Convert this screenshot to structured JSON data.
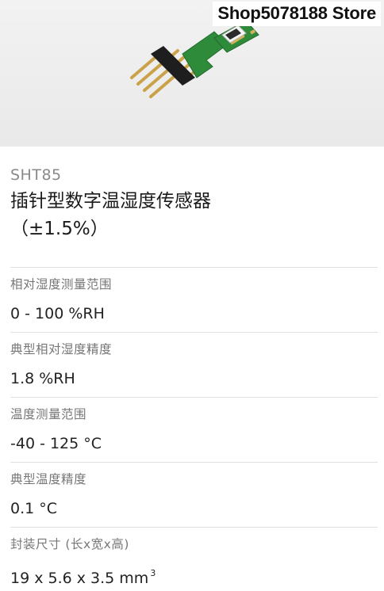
{
  "store_badge": "Shop5078188 Store",
  "product": {
    "model": "SHT85",
    "title_line1": "插针型数字温湿度传感器",
    "title_line2": "（±1.5%）"
  },
  "specs": [
    {
      "label": "相对湿度测量范围",
      "value": "0 - 100 %RH"
    },
    {
      "label": "典型相对湿度精度",
      "value": "1.8 %RH"
    },
    {
      "label": "温度测量范围",
      "value": "-40 - 125 °C"
    },
    {
      "label": "典型温度精度",
      "value": "0.1 °C"
    },
    {
      "label": "封装尺寸 (长x宽x高)",
      "value": "19 x 5.6 x 3.5 mm",
      "value_sup": "3"
    }
  ],
  "colors": {
    "pcb_green": "#2e8b3a",
    "pin_gold": "#c9a24a",
    "header_black": "#1e1e1e"
  }
}
